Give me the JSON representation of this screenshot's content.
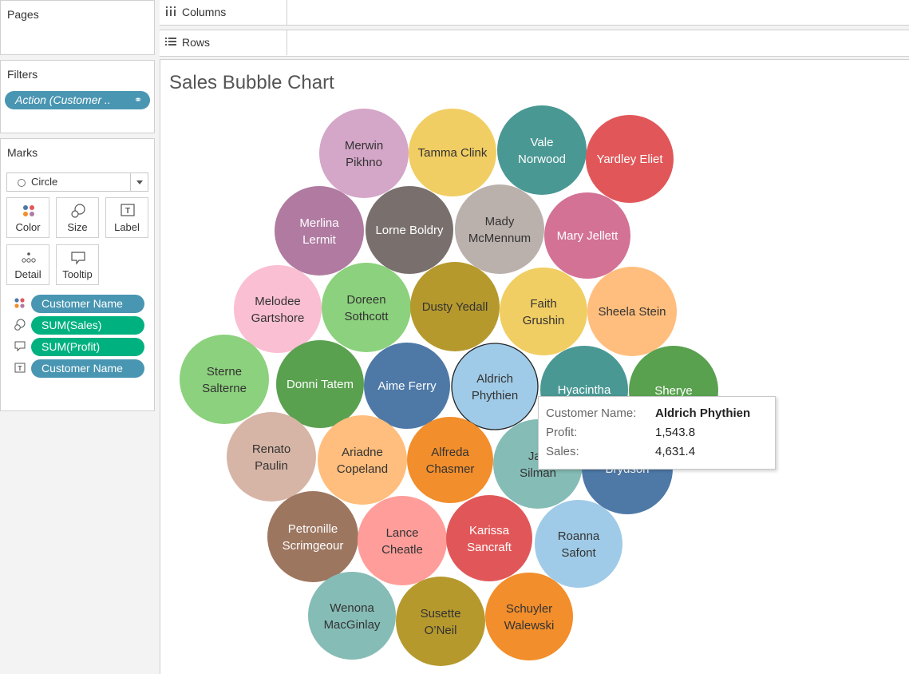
{
  "shelves": {
    "columns_label": "Columns",
    "rows_label": "Rows"
  },
  "pages": {
    "title": "Pages"
  },
  "filters": {
    "title": "Filters",
    "pill_label": "Action (Customer .."
  },
  "marks": {
    "title": "Marks",
    "type": "Circle",
    "buttons": [
      "Color",
      "Size",
      "Label",
      "Detail",
      "Tooltip"
    ],
    "fields": [
      {
        "icon": "color-icon",
        "label": "Customer Name",
        "color": "#4996b2"
      },
      {
        "icon": "size-icon",
        "label": "SUM(Sales)",
        "color": "#00b180"
      },
      {
        "icon": "tooltip-icon",
        "label": "SUM(Profit)",
        "color": "#00b180"
      },
      {
        "icon": "label-icon",
        "label": "Customer Name",
        "color": "#4996b2"
      }
    ]
  },
  "chart_title": "Sales Bubble Chart",
  "chart_data": {
    "type": "bubble",
    "title": "Sales Bubble Chart",
    "size_measure": "SUM(Sales)",
    "color_dimension": "Customer Name",
    "customers": [
      {
        "name": "Merwin Pikhno",
        "color": "#d4a6c8"
      },
      {
        "name": "Tamma Clink",
        "color": "#f1ce63"
      },
      {
        "name": "Vale Norwood",
        "color": "#499894"
      },
      {
        "name": "Yardley Eliet",
        "color": "#e15759"
      },
      {
        "name": "Merlina Lermit",
        "color": "#b07aa1"
      },
      {
        "name": "Lorne Boldry",
        "color": "#79706e"
      },
      {
        "name": "Mady McMennum",
        "color": "#bab0ac"
      },
      {
        "name": "Mary Jellett",
        "color": "#d37295"
      },
      {
        "name": "Melodee Gartshore",
        "color": "#fabfd2"
      },
      {
        "name": "Doreen Sothcott",
        "color": "#8cd17d"
      },
      {
        "name": "Dusty Yedall",
        "color": "#b6992d"
      },
      {
        "name": "Faith Grushin",
        "color": "#f1ce63"
      },
      {
        "name": "Sheela Stein",
        "color": "#ffbe7d"
      },
      {
        "name": "Sterne Salterne",
        "color": "#8cd17d"
      },
      {
        "name": "Donni Tatem",
        "color": "#59a14f"
      },
      {
        "name": "Aime Ferry",
        "color": "#4e79a7"
      },
      {
        "name": "Aldrich Phythien",
        "color": "#a0cbe8",
        "selected": true
      },
      {
        "name": "Hyacintha",
        "color": "#499894"
      },
      {
        "name": "Sherye",
        "color": "#59a14f"
      },
      {
        "name": "Renato Paulin",
        "color": "#d7b5a6"
      },
      {
        "name": "Ariadne Copeland",
        "color": "#ffbe7d"
      },
      {
        "name": "Alfreda Chasmer",
        "color": "#f28e2b"
      },
      {
        "name": "Jan Silman",
        "color": "#86bcb6"
      },
      {
        "name": "Brydson",
        "color": "#4e79a7"
      },
      {
        "name": "Petronille Scrimgeour",
        "color": "#9d7660"
      },
      {
        "name": "Lance Cheatle",
        "color": "#ff9d9a"
      },
      {
        "name": "Karissa Sancraft",
        "color": "#e15759"
      },
      {
        "name": "Roanna Safont",
        "color": "#a0cbe8"
      },
      {
        "name": "Wenona MacGinlay",
        "color": "#86bcb6"
      },
      {
        "name": "Susette O’Neil",
        "color": "#b6992d"
      },
      {
        "name": "Schuyler Walewski",
        "color": "#f28e2b"
      }
    ]
  },
  "tooltip": {
    "rows": [
      {
        "label": "Customer Name:",
        "value": "Aldrich Phythien"
      },
      {
        "label": "Profit:",
        "value": "1,543.8"
      },
      {
        "label": "Sales:",
        "value": "4,631.4"
      }
    ]
  }
}
